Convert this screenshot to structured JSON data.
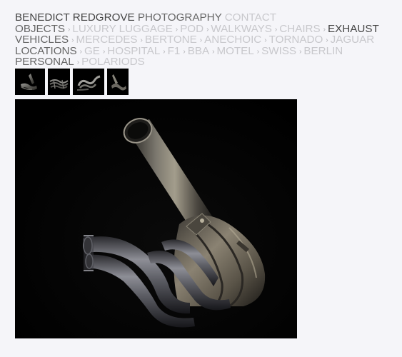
{
  "header": {
    "name": "BENEDICT REDGROVE",
    "photography": "PHOTOGRAPHY",
    "contact": "CONTACT"
  },
  "nav": {
    "separator": "›",
    "objects": {
      "label": "OBJECTS",
      "items": [
        "LUXURY LUGGAGE",
        "POD",
        "WALKWAYS",
        "CHAIRS",
        "EXHAUST"
      ]
    },
    "vehicles": {
      "label": "VEHICLES",
      "items": [
        "MERCEDES",
        "BERTONE",
        "ANECHOIC",
        "TORNADO",
        "JAGUAR"
      ]
    },
    "locations": {
      "label": "LOCATIONS",
      "items": [
        "GE",
        "HOSPITAL",
        "F1",
        "BBA",
        "MOTEL",
        "SWISS",
        "BERLIN"
      ]
    },
    "personal": {
      "label": "PERSONAL",
      "items": [
        "POLARIODS"
      ]
    }
  },
  "gallery": {
    "thumbnails": [
      "exhaust-1",
      "exhaust-2",
      "exhaust-3",
      "exhaust-4"
    ],
    "selected_index": 0
  },
  "colors": {
    "background": "#f5f5f9",
    "active_text": "#444444",
    "inactive_text": "#c8c8cc",
    "photo_background": "#000000"
  }
}
